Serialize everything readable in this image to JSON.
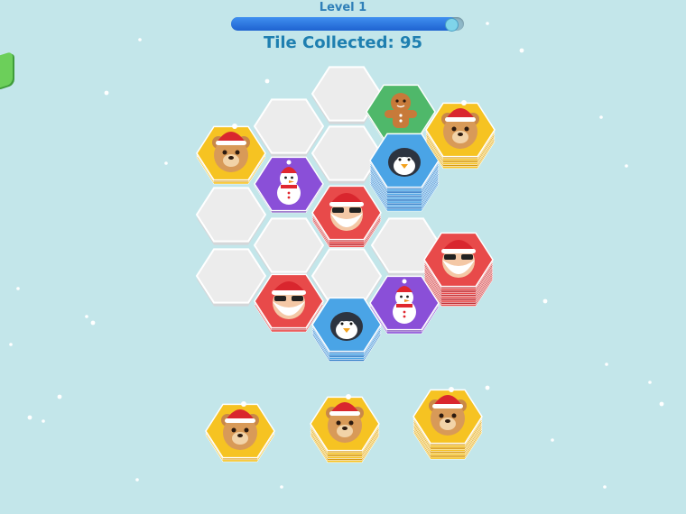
{
  "header": {
    "level_label": "Level 1",
    "tiles_collected_label": "Tile Collected: 95",
    "progress": 0.97
  },
  "colors": {
    "background": "#c3e6ea",
    "empty_cell": "#ececec",
    "yellow": "#f6c322",
    "purple": "#8a4fd8",
    "red": "#e84a4a",
    "blue": "#4aa4e6",
    "green": "#4fb86a"
  },
  "board": {
    "cells": [
      {
        "name": "empty",
        "color": "empty",
        "layers": 0
      },
      {
        "name": "empty",
        "color": "empty",
        "layers": 0
      },
      {
        "name": "empty",
        "color": "empty",
        "layers": 0
      },
      {
        "name": "empty",
        "color": "empty",
        "layers": 0
      },
      {
        "name": "empty",
        "color": "empty",
        "layers": 0
      },
      {
        "name": "empty",
        "color": "empty",
        "layers": 0
      },
      {
        "name": "empty",
        "color": "empty",
        "layers": 0
      },
      {
        "name": "empty",
        "color": "empty",
        "layers": 0
      },
      {
        "name": "teddy-bear",
        "color": "yellow",
        "layers": 2
      },
      {
        "name": "snowman",
        "color": "purple",
        "layers": 1
      },
      {
        "name": "santa",
        "color": "red",
        "layers": 4
      },
      {
        "name": "gingerbread",
        "color": "green",
        "layers": 1
      },
      {
        "name": "penguin",
        "color": "blue",
        "layers": 12
      },
      {
        "name": "teddy-bear",
        "color": "yellow",
        "layers": 6
      },
      {
        "name": "santa",
        "color": "red",
        "layers": 10
      },
      {
        "name": "santa",
        "color": "red",
        "layers": 2
      },
      {
        "name": "penguin",
        "color": "blue",
        "layers": 5
      },
      {
        "name": "snowman",
        "color": "purple",
        "layers": 2
      }
    ]
  },
  "tray": {
    "slots": [
      {
        "name": "teddy-bear",
        "color": "yellow",
        "layers": 2
      },
      {
        "name": "teddy-bear",
        "color": "yellow",
        "layers": 6
      },
      {
        "name": "teddy-bear",
        "color": "yellow",
        "layers": 8
      }
    ]
  }
}
